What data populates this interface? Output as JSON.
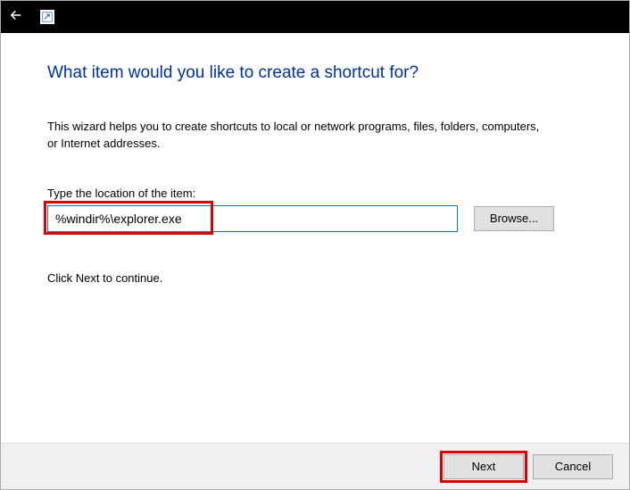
{
  "titlebar": {
    "icon_name": "shortcut-wizard-icon"
  },
  "content": {
    "heading": "What item would you like to create a shortcut for?",
    "description": "This wizard helps you to create shortcuts to local or network programs, files, folders, computers, or Internet addresses.",
    "field_label": "Type the location of the item:",
    "location_value": "%windir%\\explorer.exe",
    "browse_label": "Browse...",
    "continue_text": "Click Next to continue."
  },
  "footer": {
    "next_label": "Next",
    "cancel_label": "Cancel"
  },
  "highlights": {
    "input_highlighted": true,
    "next_highlighted": true
  }
}
